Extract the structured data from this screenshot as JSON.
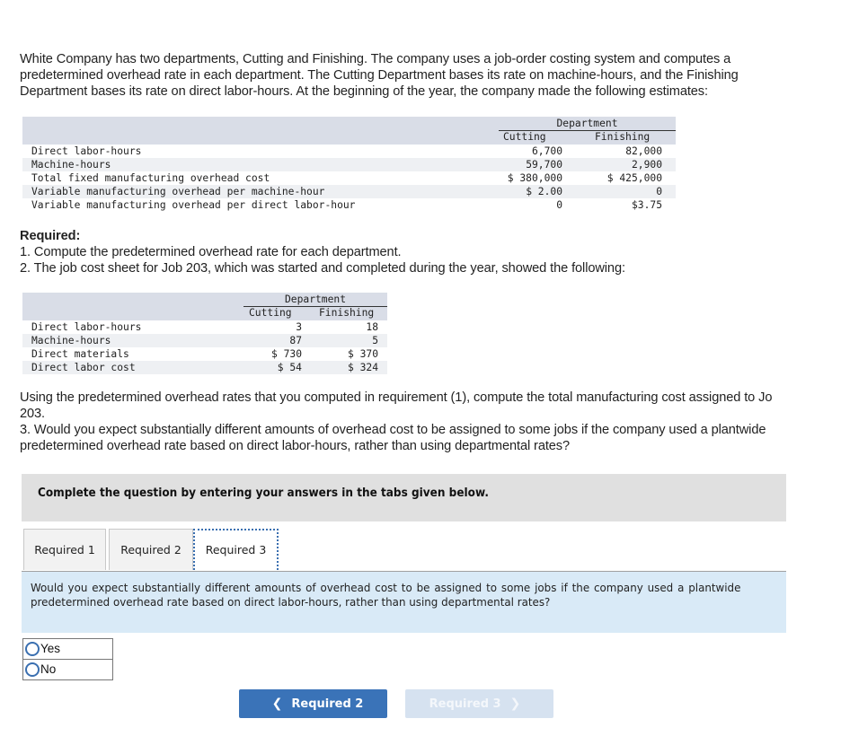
{
  "intro": {
    "line1": "White Company has two departments, Cutting and Finishing. The company uses a job-order costing system and computes a",
    "line2": "predetermined overhead rate in each department. The Cutting Department bases its rate on machine-hours, and the Finishing",
    "line3": "Department bases its rate on direct labor-hours. At the beginning of the year, the company made the following estimates:"
  },
  "estimates_table": {
    "group_header": "Department",
    "columns": [
      "Cutting",
      "Finishing"
    ],
    "rows": [
      {
        "label": "Direct labor-hours",
        "cutting": "6,700",
        "finishing": "82,000"
      },
      {
        "label": "Machine-hours",
        "cutting": "59,700",
        "finishing": "2,900"
      },
      {
        "label": "Total fixed manufacturing overhead cost",
        "cutting": "$ 380,000",
        "finishing": "$ 425,000"
      },
      {
        "label": "Variable manufacturing overhead per machine-hour",
        "cutting": "$ 2.00",
        "finishing": "0"
      },
      {
        "label": "Variable manufacturing overhead per direct labor-hour",
        "cutting": "0",
        "finishing": "$3.75"
      }
    ]
  },
  "required": {
    "heading": "Required:",
    "item1": "1. Compute the predetermined overhead rate for each department.",
    "item2": "2. The job cost sheet for Job 203, which was started and completed during the year, showed the following:"
  },
  "job_table": {
    "group_header": "Department",
    "columns": [
      "Cutting",
      "Finishing"
    ],
    "rows": [
      {
        "label": "Direct labor-hours",
        "cutting": "3",
        "finishing": "18"
      },
      {
        "label": "Machine-hours",
        "cutting": "87",
        "finishing": "5"
      },
      {
        "label": "Direct materials",
        "cutting": "$ 730",
        "finishing": "$ 370"
      },
      {
        "label": "Direct labor cost",
        "cutting": "$ 54",
        "finishing": "$ 324"
      }
    ]
  },
  "followup": {
    "line1": "Using the predetermined overhead rates that you computed in requirement (1), compute the total manufacturing cost assigned to Jo",
    "line2": "203.",
    "line3": "3. Would you expect substantially different amounts of overhead cost to be assigned to some jobs if the company used a plantwide",
    "line4": "predetermined overhead rate based on direct labor-hours, rather than using departmental rates?"
  },
  "instructions": "Complete the question by entering your answers in the tabs given below.",
  "tabs": [
    {
      "label": "Required 1",
      "active": false
    },
    {
      "label": "Required 2",
      "active": false
    },
    {
      "label": "Required 3",
      "active": true
    }
  ],
  "question_panel": "Would you expect substantially different amounts of overhead cost to be assigned to some jobs if the company used a plantwide predetermined overhead rate based on direct labor-hours, rather than using departmental rates?",
  "answer_options": [
    {
      "label": "Yes",
      "selected": false
    },
    {
      "label": "No",
      "selected": false
    }
  ],
  "navigation": {
    "prev_label": "Required 2",
    "next_label": "Required 3",
    "next_enabled": false
  },
  "colors": {
    "primary_button": "#3a73b8",
    "disabled_button": "#d6e2f0",
    "table_header": "#d9dde7",
    "question_panel": "#d9eaf7",
    "instruction_box": "#e0e0e0"
  }
}
